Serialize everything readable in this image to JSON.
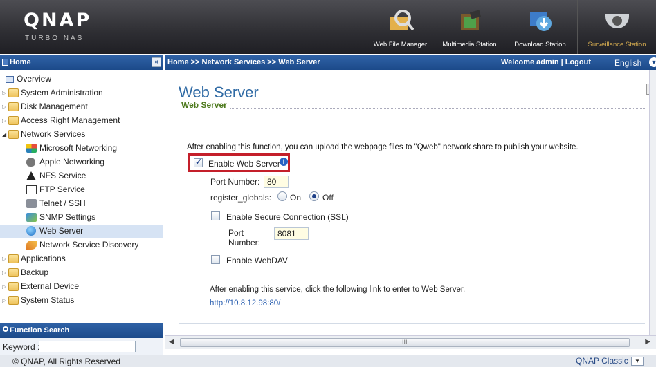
{
  "header": {
    "logo": "QNAP",
    "logo_sub": "TURBO NAS",
    "apps": [
      {
        "label": "Web File Manager",
        "icon": "web-file-manager-icon"
      },
      {
        "label": "Multimedia Station",
        "icon": "multimedia-station-icon"
      },
      {
        "label": "Download Station",
        "icon": "download-station-icon"
      },
      {
        "label": "Surveillance Station",
        "icon": "surveillance-station-icon"
      }
    ]
  },
  "left": {
    "title": "Home",
    "collapse": "«",
    "tree": [
      {
        "label": "Overview"
      },
      {
        "label": "System Administration"
      },
      {
        "label": "Disk Management"
      },
      {
        "label": "Access Right Management"
      },
      {
        "label": "Network Services"
      },
      {
        "label": "Microsoft Networking"
      },
      {
        "label": "Apple Networking"
      },
      {
        "label": "NFS Service"
      },
      {
        "label": "FTP Service"
      },
      {
        "label": "Telnet / SSH"
      },
      {
        "label": "SNMP Settings"
      },
      {
        "label": "Web Server"
      },
      {
        "label": "Network Service Discovery"
      },
      {
        "label": "Applications"
      },
      {
        "label": "Backup"
      },
      {
        "label": "External Device"
      },
      {
        "label": "System Status"
      }
    ],
    "function_search": {
      "title": "Function Search",
      "keyword_label": "Keyword :",
      "keyword_value": ""
    }
  },
  "topbar": {
    "breadcrumb": "Home >> Network Services >> Web Server",
    "welcome": "Welcome admin | Logout",
    "language": "English"
  },
  "main": {
    "title": "Web Server",
    "section": "Web Server",
    "description": "After enabling this function, you can upload the webpage files to \"Qweb\" network share to publish your website.",
    "enable_web_server": {
      "label": "Enable Web Server",
      "checked": true
    },
    "port_label": "Port Number:",
    "port_value": "80",
    "register_globals_label": "register_globals:",
    "on_label": "On",
    "off_label": "Off",
    "register_globals_value": "Off",
    "ssl": {
      "label": "Enable Secure Connection (SSL)",
      "checked": false
    },
    "ssl_port_label_1": "Port",
    "ssl_port_label_2": "Number:",
    "ssl_port_value": "8081",
    "webdav": {
      "label": "Enable WebDAV",
      "checked": false
    },
    "link_text": "After enabling this service, click the following link to enter to Web Server.",
    "link_url": "http://10.8.12.98:80/"
  },
  "footer": {
    "copyright": "© QNAP, All Rights Reserved",
    "theme": "QNAP Classic"
  },
  "colors": {
    "accent": "#1c4a8a",
    "title": "#2f6aa4",
    "highlight": "#c41f2a",
    "section": "#4e7a1e"
  }
}
